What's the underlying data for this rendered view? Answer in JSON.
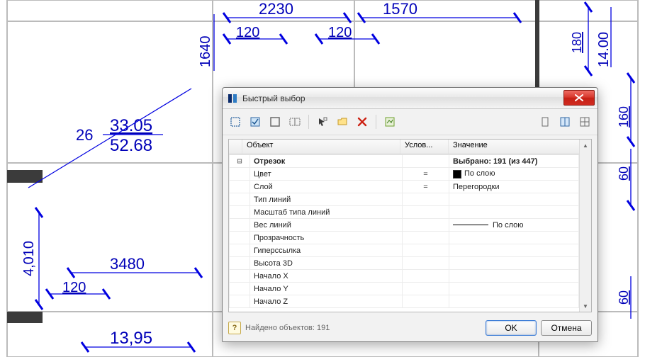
{
  "cad": {
    "dims": {
      "top1": "2230",
      "top2": "1570",
      "d120a": "120",
      "d120b": "120",
      "d1640": "1640",
      "d14_00": "14.00",
      "d180": "180",
      "d160": "160",
      "d60a": "60",
      "d60b": "60",
      "d4010": "4,010",
      "d3480": "3480",
      "d120c": "120",
      "d13_95": "13,95",
      "d26": "26",
      "d33_05": "33.05",
      "d52_68": "52.68"
    }
  },
  "dialog": {
    "title": "Быстрый выбор",
    "close_tooltip": "Закрыть",
    "headers": {
      "object": "Объект",
      "cond": "Услов...",
      "value": "Значение"
    },
    "group": {
      "label": "Отрезок",
      "selected_text": "Выбрано: 191 (из 447)"
    },
    "rows": [
      {
        "obj": "Цвет",
        "cond": "=",
        "val_swatch": true,
        "val": "По слою"
      },
      {
        "obj": "Слой",
        "cond": "=",
        "val": "Перегородки"
      },
      {
        "obj": "Тип линий",
        "cond": "",
        "val": ""
      },
      {
        "obj": "Масштаб типа линий",
        "cond": "",
        "val": ""
      },
      {
        "obj": "Вес линий",
        "cond": "",
        "val_lineweight": true,
        "val": "По слою"
      },
      {
        "obj": "Прозрачность",
        "cond": "",
        "val": ""
      },
      {
        "obj": "Гиперссылка",
        "cond": "",
        "val": ""
      },
      {
        "obj": "Высота 3D",
        "cond": "",
        "val": ""
      },
      {
        "obj": "Начало X",
        "cond": "",
        "val": ""
      },
      {
        "obj": "Начало Y",
        "cond": "",
        "val": ""
      },
      {
        "obj": "Начало Z",
        "cond": "",
        "val": ""
      }
    ],
    "status": "Найдено объектов: 191",
    "ok": "OK",
    "cancel": "Отмена"
  }
}
